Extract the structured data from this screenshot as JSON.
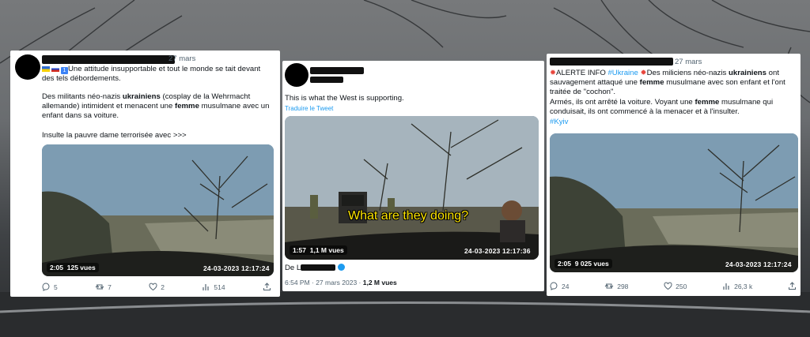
{
  "tweets": [
    {
      "date": "27 mars",
      "text_line1": "Une attitude insupportable et tout le monde se tait devant des tels débordements.",
      "text_p2_a": "Des militants néo-nazis ",
      "text_p2_b": "ukrainiens",
      "text_p2_c": " (cosplay de la Wehrmacht allemande) intimident et menacent une ",
      "text_p2_d": "femme",
      "text_p2_e": " musulmane avec un enfant dans sa voiture.",
      "text_p3": "Insulte la pauvre dame terrorisée avec >>>",
      "badge": "1",
      "video": {
        "duration": "2:05",
        "views": "125 vues",
        "timestamp": "24-03-2023 12:17:24"
      },
      "actions": {
        "replies": "5",
        "retweets": "7",
        "likes": "2",
        "views": "514"
      }
    },
    {
      "text": "This is what the West is supporting.",
      "translate": "Traduire le Tweet",
      "video": {
        "duration": "1:57",
        "views": "1,1 M vues",
        "timestamp": "24-03-2023 12:17:36",
        "caption": "What are they doing?"
      },
      "from_prefix": "De L",
      "meta_time": "6:54 PM · 27 mars 2023 · ",
      "meta_views": "1,2 M vues"
    },
    {
      "date": "27 mars",
      "alert_label": "ALERTE INFO",
      "hashtag1": "#Ukraine",
      "text_a": "Des miliciens néo-nazis ",
      "text_b": "ukrainiens",
      "text_c": " ont sauvagement attaqué une ",
      "text_d": "femme",
      "text_e": " musulmane avec son enfant et l'ont traitée de \"cochon\".",
      "text_f": "Armés, ils ont arrêté la voiture. Voyant une ",
      "text_g": "femme",
      "text_h": " musulmane qui conduisait, ils ont commencé à la menacer et à l'insulter.",
      "hashtag2": "#Kyiv",
      "video": {
        "duration": "2:05",
        "views": "9 025 vues",
        "timestamp": "24-03-2023 12:17:24"
      },
      "actions": {
        "replies": "24",
        "retweets": "298",
        "likes": "250",
        "views": "26,3 k"
      }
    }
  ],
  "colors": {
    "link": "#1d9bf0",
    "muted": "#536471",
    "caption": "#ffe600"
  }
}
